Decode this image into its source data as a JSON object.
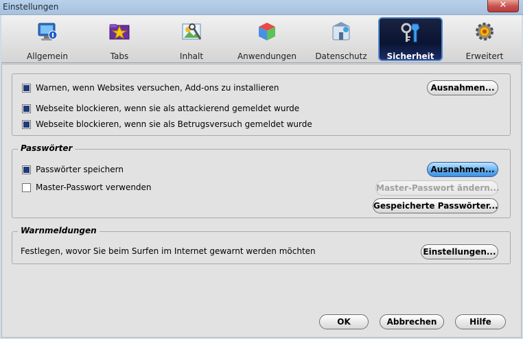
{
  "window": {
    "title": "Einstellungen",
    "close_label": "✕"
  },
  "tabs": [
    {
      "label": "Allgemein",
      "icon": "general-monitor-icon"
    },
    {
      "label": "Tabs",
      "icon": "tabs-icon"
    },
    {
      "label": "Inhalt",
      "icon": "content-icon"
    },
    {
      "label": "Anwendungen",
      "icon": "applications-icon"
    },
    {
      "label": "Datenschutz",
      "icon": "privacy-icon"
    },
    {
      "label": "Sicherheit",
      "icon": "security-keys-icon",
      "active": true
    },
    {
      "label": "Erweitert",
      "icon": "advanced-gear-icon"
    }
  ],
  "addons": {
    "warn_label": "Warnen, wenn Websites versuchen, Add-ons zu installieren",
    "warn_checked": true,
    "exceptions_button": "Ausnahmen...",
    "block_attack_label": "Webseite blockieren, wenn sie als attackierend gemeldet wurde",
    "block_attack_checked": true,
    "block_fraud_label": "Webseite blockieren, wenn sie als Betrugsversuch gemeldet wurde",
    "block_fraud_checked": true
  },
  "passwords": {
    "legend": "Passwörter",
    "save_label": "Passwörter speichern",
    "save_checked": true,
    "exceptions_button": "Ausnahmen...",
    "master_label": "Master-Passwort verwenden",
    "master_checked": false,
    "change_master_button": "Master-Passwort ändern...",
    "saved_passwords_button": "Gespeicherte Passwörter..."
  },
  "warnings": {
    "legend": "Warnmeldungen",
    "description": "Festlegen, wovor Sie beim Surfen im Internet gewarnt werden möchten",
    "settings_button": "Einstellungen..."
  },
  "footer": {
    "ok_button": "OK",
    "cancel_button": "Abbrechen",
    "help_button": "Hilfe"
  },
  "colors": {
    "active_tab_bg": "#0a1433",
    "active_tab_border": "#4f86d0",
    "primary_button": "#6db6f2",
    "checkbox_fill": "#1f3b78"
  }
}
